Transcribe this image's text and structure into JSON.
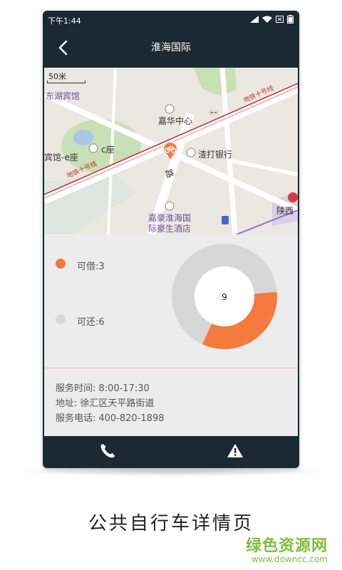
{
  "status_bar": {
    "time": "下午1:44",
    "icons": [
      "signal-icon",
      "wifi-icon",
      "sim-icon",
      "battery-icon"
    ]
  },
  "nav": {
    "back_icon": "chevron-left-icon",
    "title": "淮海国际"
  },
  "map": {
    "scale_label": "50米",
    "pois": {
      "donghu": "东湖宾馆",
      "jiahua": "嘉华中心",
      "binguan_e": "宾馆-e座",
      "c_zuo": "c座",
      "zhada": "渣打银行",
      "jiahao_1": "嘉豪淮海国",
      "jiahao_2": "际豪生酒店",
      "shanxi": "陕西",
      "road": "路"
    },
    "metro_labels": [
      "地铁十号线",
      "地铁十号线"
    ],
    "colors": {
      "metro_line": "#c0303a",
      "marker": "#f47a3e",
      "green": "#c8e0b6",
      "water": "#a8c6ea"
    }
  },
  "availability": {
    "borrow_label": "可借:3",
    "return_label": "可还:6",
    "total": "9",
    "borrow_count": 3,
    "return_count": 6,
    "colors": {
      "borrow": "#f47a3e",
      "return": "#d7d7d7"
    }
  },
  "info": {
    "hours_label": "服务时间:",
    "hours_value": "8:00-17:30",
    "address_label": "地址:",
    "address_value": "徐汇区天平路街道",
    "phone_label": "服务电话:",
    "phone_value": "400-820-1898"
  },
  "bottom_bar": {
    "icons": [
      "phone-icon",
      "warning-icon"
    ]
  },
  "caption": "公共自行车详情页",
  "watermark": {
    "title": "绿色资源网",
    "url": "www.downcc.com"
  }
}
